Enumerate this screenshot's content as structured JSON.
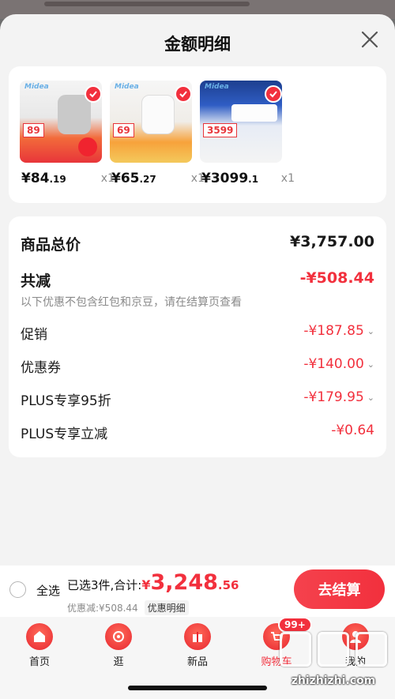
{
  "sheet": {
    "title": "金额明细"
  },
  "products": [
    {
      "brand": "Midea",
      "tag": "89",
      "price_int": "¥84",
      "price_dec": ".19",
      "qty": "x1"
    },
    {
      "brand": "Midea",
      "tag": "69",
      "price_int": "¥65",
      "price_dec": ".27",
      "qty": "x1"
    },
    {
      "brand": "Midea",
      "tag": "3599",
      "price_int": "¥3099",
      "price_dec": ".1",
      "qty": "x1"
    }
  ],
  "detail": {
    "total_label": "商品总价",
    "total_value": "¥3,757.00",
    "reduce_label": "共减",
    "reduce_value": "-¥508.44",
    "note": "以下优惠不包含红包和京豆，请在结算页查看",
    "lines": [
      {
        "label": "促销",
        "value": "-¥187.85"
      },
      {
        "label": "优惠券",
        "value": "-¥140.00"
      },
      {
        "label": "PLUS专享95折",
        "value": "-¥179.95"
      },
      {
        "label": "PLUS专享立减",
        "value": "-¥0.64"
      }
    ]
  },
  "bottom": {
    "select_all": "全选",
    "selected": "已选3件,合计:",
    "yen": "¥",
    "amount": "3,248",
    "cents": ".56",
    "discount": "优惠减:¥508.44",
    "detail_pill": "优惠明细",
    "checkout": "去结算"
  },
  "tabs": [
    {
      "label": "首页",
      "icon": "home-icon"
    },
    {
      "label": "逛",
      "icon": "discover-icon"
    },
    {
      "label": "新品",
      "icon": "gift-icon"
    },
    {
      "label": "购物车",
      "icon": "cart-icon"
    },
    {
      "label": "我的",
      "icon": "user-icon"
    }
  ],
  "cart_badge": "99+",
  "watermark": "zhizhizhi.com",
  "colors": {
    "accent": "#f2303d",
    "card": "#ffffff",
    "sheet_bg": "#f3f3f3"
  }
}
